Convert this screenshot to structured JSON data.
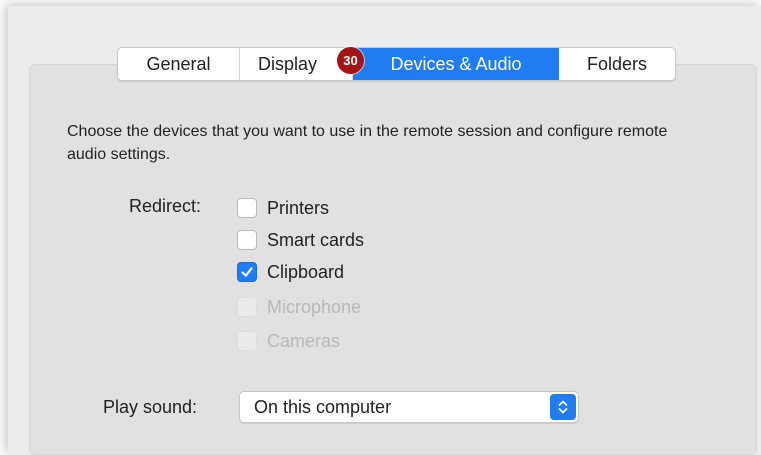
{
  "tabs": [
    {
      "label": "General"
    },
    {
      "label": "Display"
    },
    {
      "label": "Devices & Audio"
    },
    {
      "label": "Folders"
    }
  ],
  "selected_tab": "Devices & Audio",
  "badge": "30",
  "description": "Choose the devices that you want to use in the remote session and configure remote audio settings.",
  "redirect": {
    "label": "Redirect:",
    "options": [
      {
        "label": "Printers",
        "checked": false,
        "enabled": true
      },
      {
        "label": "Smart cards",
        "checked": false,
        "enabled": true
      },
      {
        "label": "Clipboard",
        "checked": true,
        "enabled": true
      },
      {
        "label": "Microphone",
        "checked": false,
        "enabled": false
      },
      {
        "label": "Cameras",
        "checked": false,
        "enabled": false
      }
    ]
  },
  "play_sound": {
    "label": "Play sound:",
    "value": "On this computer"
  },
  "colors": {
    "accent": "#1f7cf2",
    "badge": "#a51414",
    "panel": "#e1e1e1"
  },
  "icons": {
    "checkmark": "checkmark-icon",
    "select_arrows": "updown-chevron-icon"
  }
}
